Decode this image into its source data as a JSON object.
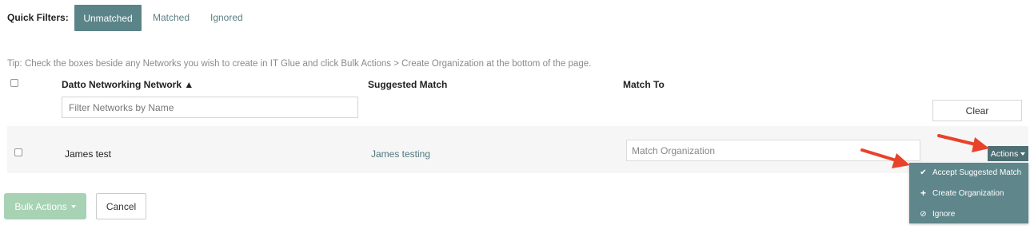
{
  "quick_filters": {
    "label": "Quick Filters:",
    "tabs": [
      {
        "label": "Unmatched",
        "active": true
      },
      {
        "label": "Matched",
        "active": false
      },
      {
        "label": "Ignored",
        "active": false
      }
    ]
  },
  "tip": "Tip: Check the boxes beside any Networks you wish to create in IT Glue and click Bulk Actions > Create Organization at the bottom of the page.",
  "table": {
    "columns": [
      "Datto Networking Network ▲",
      "Suggested Match",
      "Match To"
    ],
    "filter_placeholder": "Filter Networks by Name",
    "clear_label": "Clear",
    "rows": [
      {
        "network": "James test",
        "suggested_match": "James testing",
        "match_to_placeholder": "Match Organization",
        "actions_label": "Actions"
      }
    ]
  },
  "actions_menu": {
    "items": [
      {
        "label": "Accept Suggested Match",
        "icon": "check-icon"
      },
      {
        "label": "Create Organization",
        "icon": "plus-icon"
      },
      {
        "label": "Ignore",
        "icon": "ban-icon"
      }
    ]
  },
  "footer": {
    "bulk_actions_label": "Bulk Actions",
    "cancel_label": "Cancel"
  },
  "colors": {
    "accent": "#5b8489",
    "menu_bg": "#5e868b",
    "bulk_button": "#a7d2b4",
    "annotation_arrow": "#e8432a"
  }
}
